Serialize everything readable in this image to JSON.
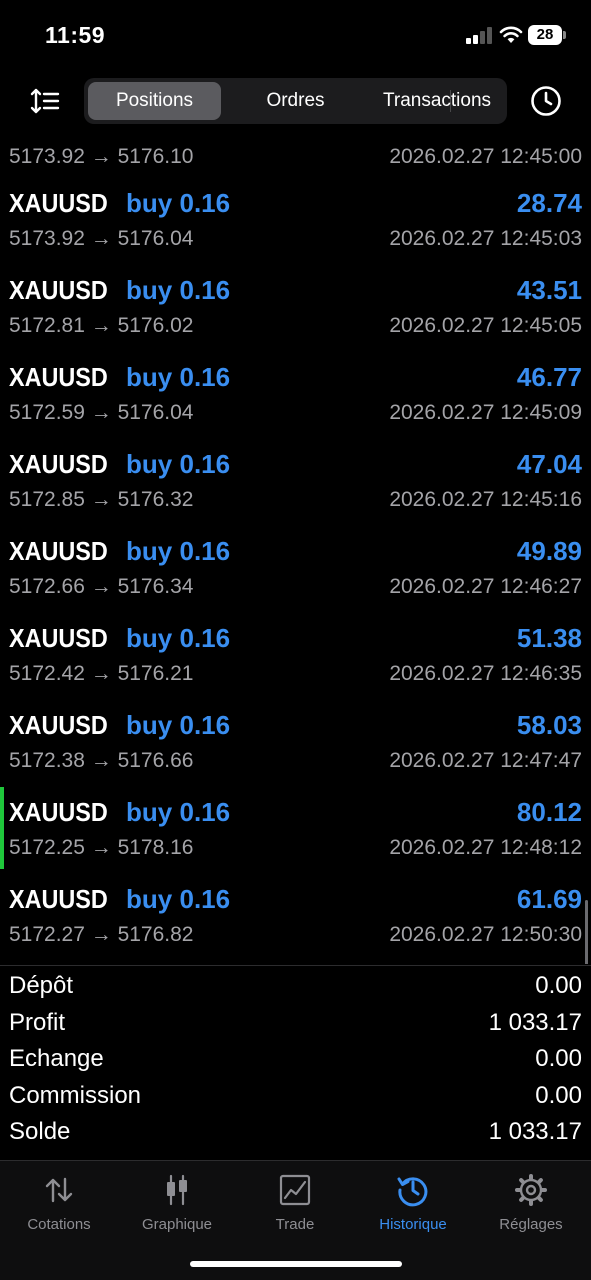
{
  "status_bar": {
    "time": "11:59",
    "battery": "28"
  },
  "toolbar": {
    "tabs": [
      {
        "label": "Positions"
      },
      {
        "label": "Ordres"
      },
      {
        "label": "Transactions"
      }
    ],
    "active_tab": "Positions"
  },
  "partial_row": {
    "prices": "5173.92 → 5176.10",
    "time": "2026.02.27 12:45:00"
  },
  "rows": [
    {
      "symbol": "XAUUSD",
      "side": "buy 0.16",
      "profit": "28.74",
      "prices": "5173.92 → 5176.04",
      "time": "2026.02.27 12:45:03"
    },
    {
      "symbol": "XAUUSD",
      "side": "buy 0.16",
      "profit": "43.51",
      "prices": "5172.81 → 5176.02",
      "time": "2026.02.27 12:45:05"
    },
    {
      "symbol": "XAUUSD",
      "side": "buy 0.16",
      "profit": "46.77",
      "prices": "5172.59 → 5176.04",
      "time": "2026.02.27 12:45:09"
    },
    {
      "symbol": "XAUUSD",
      "side": "buy 0.16",
      "profit": "47.04",
      "prices": "5172.85 → 5176.32",
      "time": "2026.02.27 12:45:16"
    },
    {
      "symbol": "XAUUSD",
      "side": "buy 0.16",
      "profit": "49.89",
      "prices": "5172.66 → 5176.34",
      "time": "2026.02.27 12:46:27"
    },
    {
      "symbol": "XAUUSD",
      "side": "buy 0.16",
      "profit": "51.38",
      "prices": "5172.42 → 5176.21",
      "time": "2026.02.27 12:46:35"
    },
    {
      "symbol": "XAUUSD",
      "side": "buy 0.16",
      "profit": "58.03",
      "prices": "5172.38 → 5176.66",
      "time": "2026.02.27 12:47:47"
    },
    {
      "symbol": "XAUUSD",
      "side": "buy 0.16",
      "profit": "80.12",
      "prices": "5172.25 → 5178.16",
      "time": "2026.02.27 12:48:12"
    },
    {
      "symbol": "XAUUSD",
      "side": "buy 0.16",
      "profit": "61.69",
      "prices": "5172.27 → 5176.82",
      "time": "2026.02.27 12:50:30"
    }
  ],
  "summary": [
    {
      "label": "Dépôt",
      "value": "0.00"
    },
    {
      "label": "Profit",
      "value": "1 033.17"
    },
    {
      "label": "Echange",
      "value": "0.00"
    },
    {
      "label": "Commission",
      "value": "0.00"
    },
    {
      "label": "Solde",
      "value": "1 033.17"
    }
  ],
  "tabbar": [
    {
      "label": "Cotations",
      "icon": "arrows-up-down-icon"
    },
    {
      "label": "Graphique",
      "icon": "candlestick-icon"
    },
    {
      "label": "Trade",
      "icon": "trade-chart-icon"
    },
    {
      "label": "Historique",
      "icon": "history-clock-icon"
    },
    {
      "label": "Réglages",
      "icon": "gear-icon"
    }
  ],
  "active_bottom_tab": "Historique",
  "colors": {
    "accent": "#3a8ef0",
    "marker": "#1fc73b",
    "muted": "#a4a4a8",
    "background": "#000000"
  }
}
